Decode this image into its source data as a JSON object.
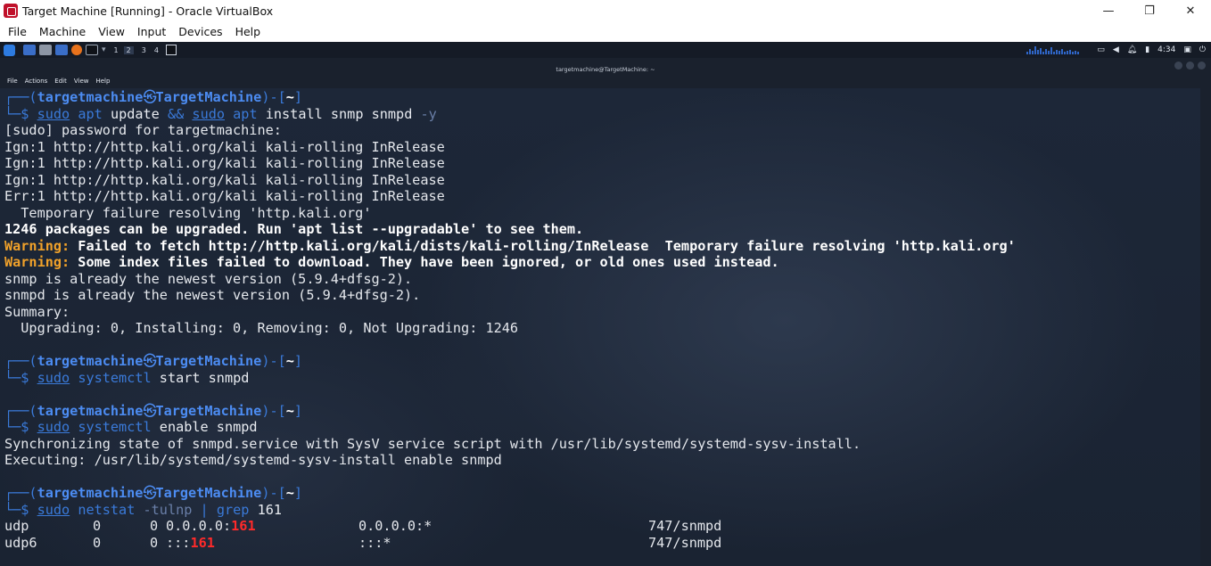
{
  "window": {
    "title": "Target Machine [Running] - Oracle VirtualBox",
    "controls": {
      "minimize": "—",
      "maximize": "❐",
      "close": "✕"
    }
  },
  "menu": [
    "File",
    "Machine",
    "View",
    "Input",
    "Devices",
    "Help"
  ],
  "kali_panel": {
    "workspaces": [
      "1",
      "2",
      "3",
      "4"
    ],
    "active_workspace": "2",
    "clock": "4:34"
  },
  "terminal": {
    "title": "targetmachine@TargetMachine: ~",
    "menu": [
      "File",
      "Actions",
      "Edit",
      "View",
      "Help"
    ],
    "prompt": {
      "open": "┌──(",
      "user": "targetmachine",
      "at_symbol": "㉿",
      "host": "TargetMachine",
      "close": ")-[",
      "cwd": "~",
      "end": "]",
      "prefix2": "└─",
      "dollar": "$"
    },
    "cmd1": {
      "sudo1": "sudo",
      "apt1": "apt",
      "update": "update",
      "and": "&&",
      "sudo2": "sudo",
      "apt2": "apt",
      "rest": "install snmp snmpd",
      "flag": "-y"
    },
    "out1": [
      "[sudo] password for targetmachine:",
      "Ign:1 http://http.kali.org/kali kali-rolling InRelease",
      "Ign:1 http://http.kali.org/kali kali-rolling InRelease",
      "Ign:1 http://http.kali.org/kali kali-rolling InRelease",
      "Err:1 http://http.kali.org/kali kali-rolling InRelease",
      "  Temporary failure resolving 'http.kali.org'"
    ],
    "upgradable": "1246 packages can be upgraded. Run 'apt list --upgradable' to see them.",
    "warning_label": "Warning:",
    "warning1": " Failed to fetch http://http.kali.org/kali/dists/kali-rolling/InRelease  Temporary failure resolving 'http.kali.org'",
    "warning2": " Some index files failed to download. They have been ignored, or old ones used instead.",
    "out2": [
      "snmp is already the newest version (5.9.4+dfsg-2).",
      "snmpd is already the newest version (5.9.4+dfsg-2).",
      "Summary:",
      "  Upgrading: 0, Installing: 0, Removing: 0, Not Upgrading: 1246"
    ],
    "cmd2": {
      "sudo": "sudo",
      "prog": "systemctl",
      "rest": "start snmpd"
    },
    "cmd3": {
      "sudo": "sudo",
      "prog": "systemctl",
      "rest": "enable snmpd"
    },
    "out3": [
      "Synchronizing state of snmpd.service with SysV service script with /usr/lib/systemd/systemd-sysv-install.",
      "Executing: /usr/lib/systemd/systemd-sysv-install enable snmpd"
    ],
    "cmd4": {
      "sudo": "sudo",
      "prog": "netstat",
      "flag": "-tulnp",
      "pipe": "|",
      "grep": "grep",
      "arg": "161"
    },
    "netstat_rows": [
      {
        "proto": "udp ",
        "recvq": "0",
        "sendq": "0",
        "local_prefix": "0.0.0.0:",
        "local_port": "161",
        "foreign": "0.0.0.0:*",
        "pid": "747/snmpd"
      },
      {
        "proto": "udp6",
        "recvq": "0",
        "sendq": "0",
        "local_prefix": ":::",
        "local_port": "161",
        "foreign": ":::*",
        "pid": "747/snmpd"
      }
    ]
  }
}
